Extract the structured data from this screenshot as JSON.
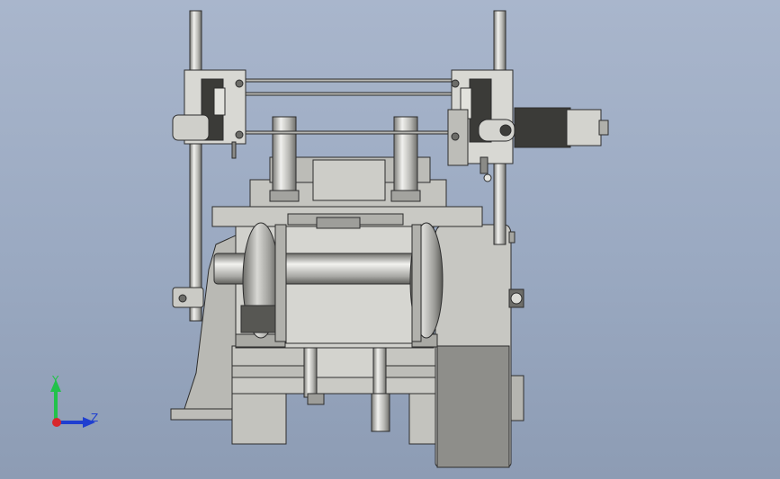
{
  "viewport": {
    "background_top": "#a9b6cc",
    "background_bottom": "#8d9cb4",
    "part_color": "#c9c9c4",
    "part_shadow": "#8f8f8b",
    "edge_color": "#2d2d2d"
  },
  "triad": {
    "y_label": "Y",
    "z_label": "Z",
    "y_color": "#22c24a",
    "z_color": "#1f3fd0",
    "x_color": "#d8262b"
  }
}
